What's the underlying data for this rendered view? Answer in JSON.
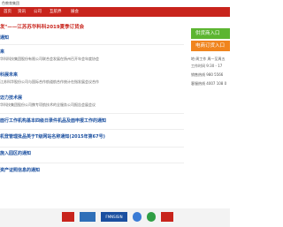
{
  "header": {
    "brand_fragment": "色教育集团"
  },
  "nav": {
    "items": [
      "首页",
      "资讯",
      "公司",
      "互航界",
      "展会"
    ]
  },
  "banner": {
    "text": "发\"——江苏苏华料科2019夏季订货会"
  },
  "list": [
    {
      "title": "通知",
      "desc": ""
    },
    {
      "title": "来",
      "desc": "华科科技集团股份有限公司联合会发展在扬州召开年会年度协会"
    },
    {
      "title": "科展未来",
      "desc": "江苏科华股份公司与国际合作航道航合作统计在指发展会议合作"
    },
    {
      "title": "迈力技术展",
      "desc": "华科技集团股份公司携专项航技术的全服务公司报告会展会议"
    },
    {
      "title": "面行工作机构基本四级日录件机品及面申报工作的通知",
      "desc": ""
    },
    {
      "title": "机登管理批品英于T级网站名称通知(2015年第67号)",
      "desc": ""
    },
    {
      "title": "施入园区的通知",
      "desc": ""
    },
    {
      "title": "资产证照信息的通知",
      "desc": ""
    }
  ],
  "sidebar": {
    "buy_button": "供货商入口",
    "sell_button": "电商订货入口",
    "info": [
      "地·周工作 周一至周五",
      "工作时间 9:30 - 17",
      "销售热线 980 5566",
      "客服热线 4007 108 0"
    ]
  },
  "footer": {
    "logo_text": "FMNSISIN"
  },
  "colors": {
    "nav_red": "#c8241c",
    "buy_green": "#5cb531",
    "sell_orange": "#f0841e",
    "link_blue": "#1a4fa0"
  }
}
